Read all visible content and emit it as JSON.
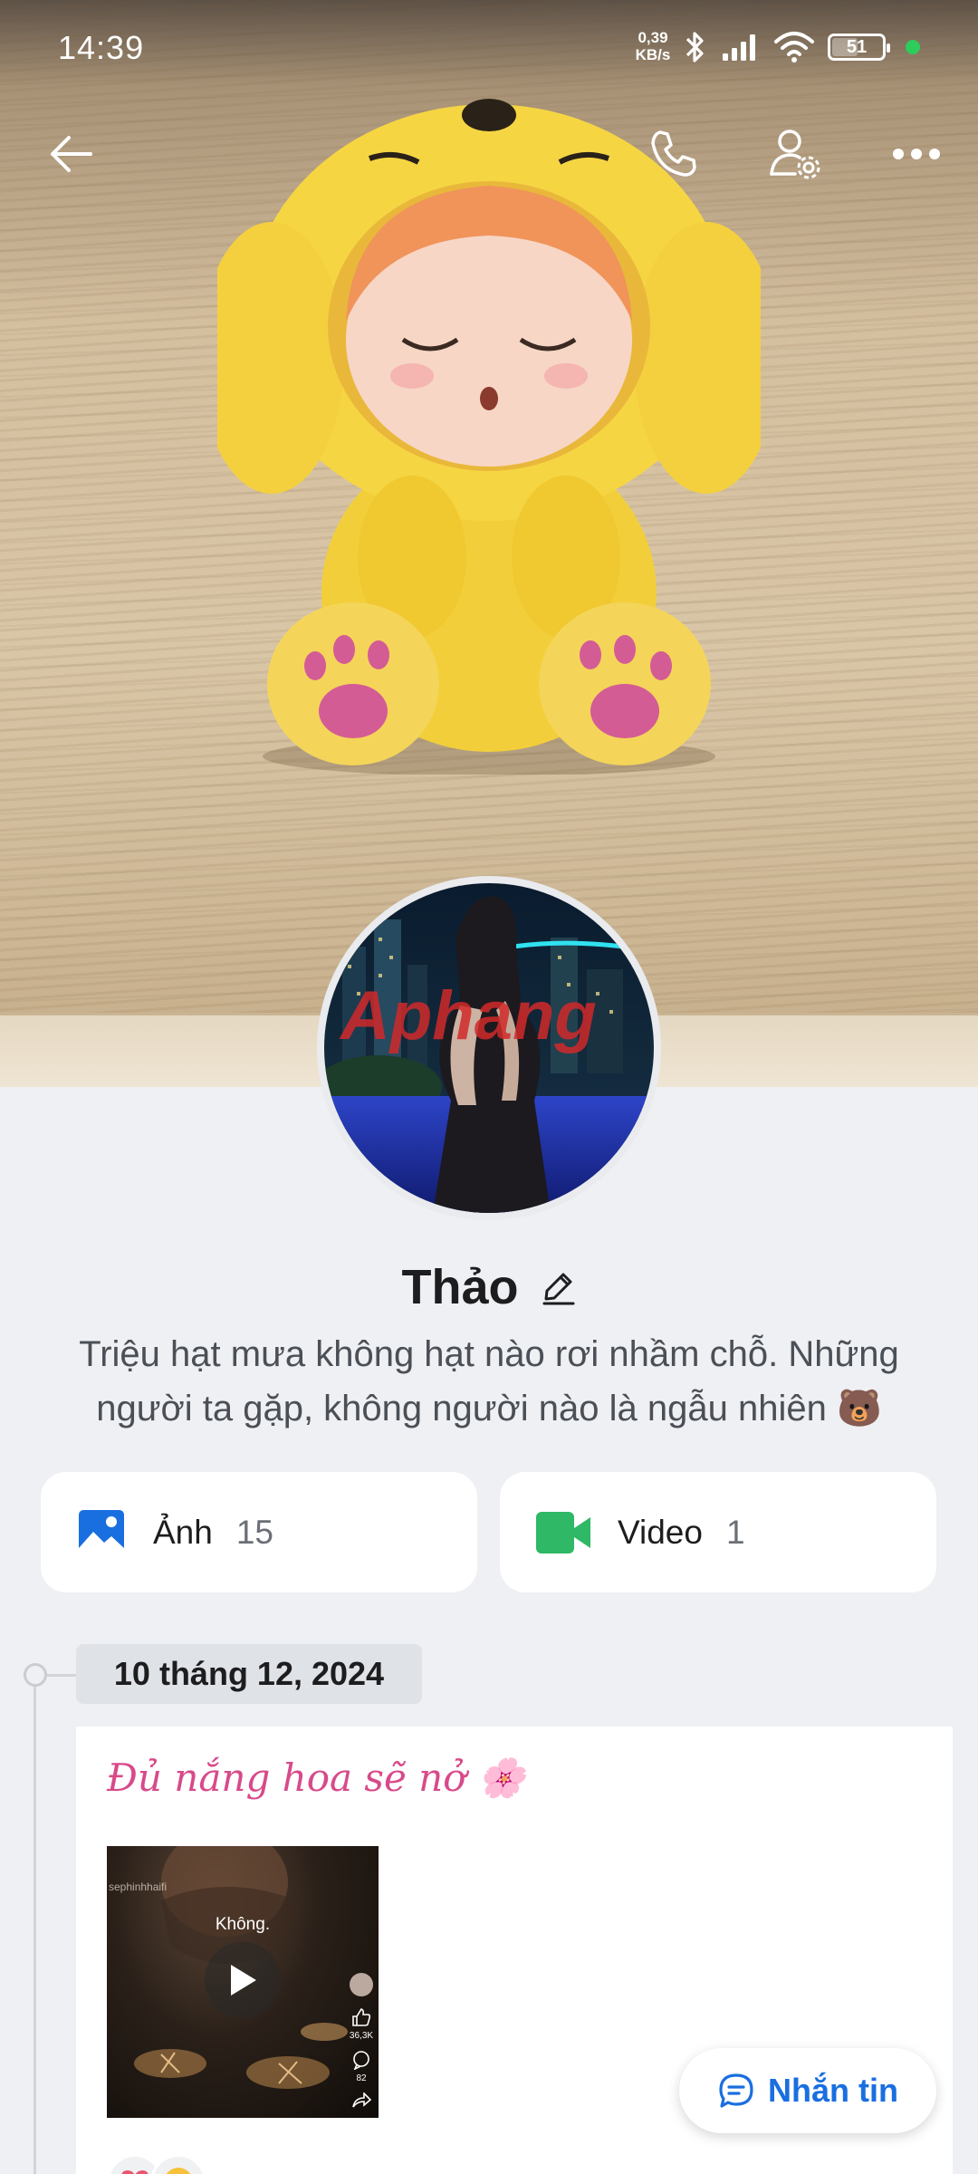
{
  "status_bar": {
    "time": "14:39",
    "speed_value": "0,39",
    "speed_unit": "KB/s",
    "battery": "51",
    "icons": [
      "bluetooth-icon",
      "signal-icon",
      "wifi-icon",
      "battery-icon"
    ]
  },
  "toolbar": {
    "icons": [
      "back-arrow-icon",
      "phone-icon",
      "user-settings-icon",
      "more-icon"
    ]
  },
  "profile": {
    "name": "Thảo",
    "bio": "Triệu hạt mưa không hạt nào rơi nhầm chỗ. Những người ta gặp, không người nào là ngẫu nhiên 🐻",
    "avatar_watermark": "Aphang"
  },
  "media": {
    "photos": {
      "label": "Ảnh",
      "count": "15",
      "icon": "image-icon",
      "color": "#1a6fe0"
    },
    "videos": {
      "label": "Video",
      "count": "1",
      "icon": "video-camera-icon",
      "color": "#2fb865"
    }
  },
  "timeline": {
    "date": "10 tháng 12, 2024",
    "post": {
      "caption": "Đủ nắng hoa sẽ nở 🌸",
      "video": {
        "watermark": "sephinhhaifi",
        "subtitle": "Không.",
        "likes": "36,3K",
        "comments": "82"
      }
    }
  },
  "fab": {
    "label": "Nhắn tin",
    "icon": "chat-bubble-icon"
  },
  "colors": {
    "accent": "#1a6fe0",
    "caption": "#d84a8a",
    "background": "#eef0f3"
  }
}
